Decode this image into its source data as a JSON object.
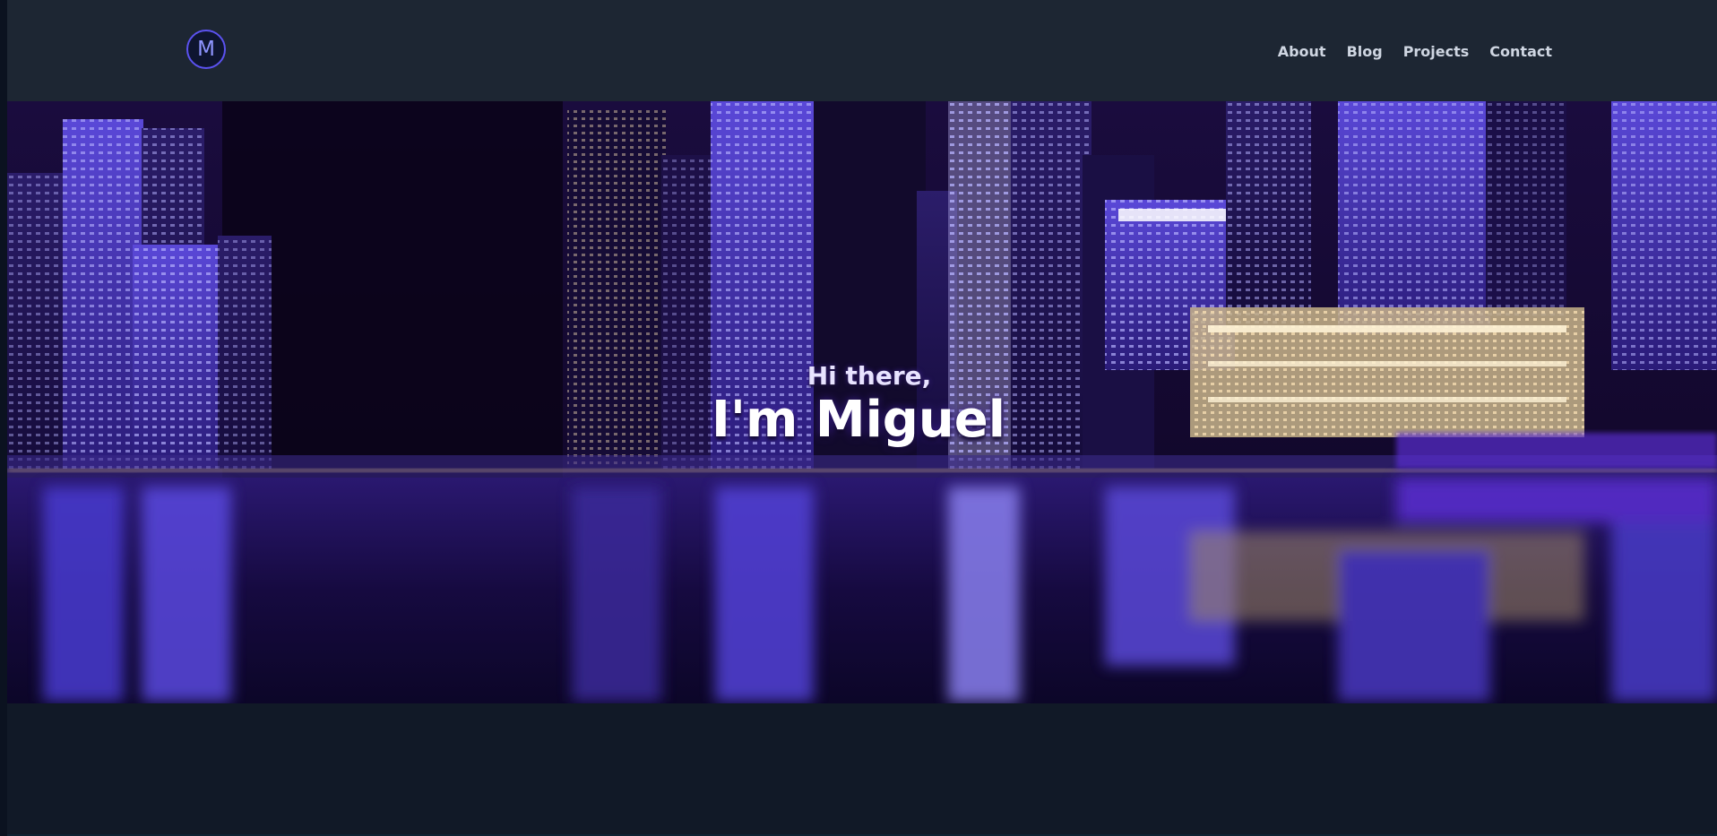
{
  "header": {
    "logo_letter": "M",
    "nav": [
      {
        "label": "About"
      },
      {
        "label": "Blog"
      },
      {
        "label": "Projects"
      },
      {
        "label": "Contact"
      }
    ]
  },
  "hero": {
    "greeting": "Hi there,",
    "title": "I'm Miguel",
    "background_image": "night-city-skyline-waterfront"
  },
  "colors": {
    "header_bg": "#1d2633",
    "page_bg": "#121a29",
    "accent": "#5b52f0",
    "nav_text": "#cfd6e2"
  }
}
